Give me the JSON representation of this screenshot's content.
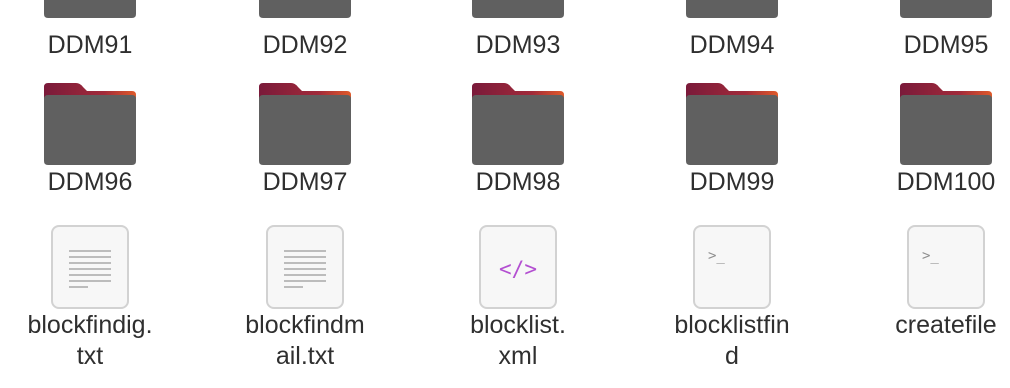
{
  "file_manager": {
    "rows": [
      [
        {
          "name": "DDM91",
          "type": "folder",
          "icon": "folder-icon"
        },
        {
          "name": "DDM92",
          "type": "folder",
          "icon": "folder-icon"
        },
        {
          "name": "DDM93",
          "type": "folder",
          "icon": "folder-icon"
        },
        {
          "name": "DDM94",
          "type": "folder",
          "icon": "folder-icon"
        },
        {
          "name": "DDM95",
          "type": "folder",
          "icon": "folder-icon"
        }
      ],
      [
        {
          "name": "DDM96",
          "type": "folder",
          "icon": "folder-icon"
        },
        {
          "name": "DDM97",
          "type": "folder",
          "icon": "folder-icon"
        },
        {
          "name": "DDM98",
          "type": "folder",
          "icon": "folder-icon"
        },
        {
          "name": "DDM99",
          "type": "folder",
          "icon": "folder-icon"
        },
        {
          "name": "DDM100",
          "type": "folder",
          "icon": "folder-icon"
        }
      ],
      [
        {
          "name": "blockfindig.txt",
          "line1": "blockfindig.",
          "line2": "txt",
          "type": "text",
          "icon": "text-file-icon"
        },
        {
          "name": "blockfindmail.txt",
          "line1": "blockfindm",
          "line2": "ail.txt",
          "type": "text",
          "icon": "text-file-icon"
        },
        {
          "name": "blocklist.xml",
          "line1": "blocklist.",
          "line2": "xml",
          "type": "xml",
          "icon": "code-file-icon",
          "glyph": "</>"
        },
        {
          "name": "blocklistfind",
          "line1": "blocklistfin",
          "line2": "d",
          "type": "script",
          "icon": "terminal-file-icon",
          "glyph": ">_"
        },
        {
          "name": "createfile",
          "line1": "createfile",
          "line2": "",
          "type": "script",
          "icon": "terminal-file-icon",
          "glyph": ">_"
        }
      ]
    ],
    "colors": {
      "folder_body": "#606060",
      "folder_tab": "#7a1a3a",
      "folder_accent": "#e05a2a",
      "label_text": "#2f2f2f",
      "xml_glyph": "#b34fd1"
    }
  }
}
